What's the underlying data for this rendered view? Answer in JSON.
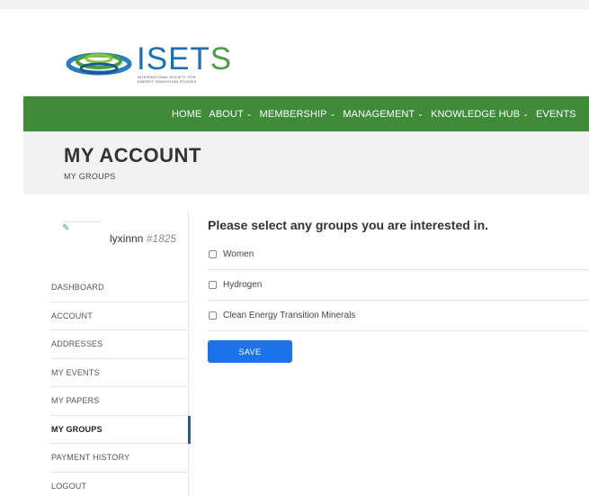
{
  "logo": {
    "word_blue": "ISET",
    "word_green": "S",
    "subtitle_line1": "INTERNATIONAL SOCIETY FOR",
    "subtitle_line2": "ENERGY TRANSITION STUDIES"
  },
  "nav": {
    "items": [
      {
        "label": "HOME",
        "dropdown": false
      },
      {
        "label": "ABOUT",
        "dropdown": true
      },
      {
        "label": "MEMBERSHIP",
        "dropdown": true
      },
      {
        "label": "MANAGEMENT",
        "dropdown": true
      },
      {
        "label": "KNOWLEDGE HUB",
        "dropdown": true
      },
      {
        "label": "EVENTS",
        "dropdown": false
      }
    ],
    "chevron": "⌄"
  },
  "header": {
    "title": "MY ACCOUNT",
    "breadcrumb": "MY GROUPS"
  },
  "user": {
    "name": "lyxinnn",
    "id": "#1825"
  },
  "sidebar": {
    "items": [
      {
        "label": "DASHBOARD",
        "active": false
      },
      {
        "label": "ACCOUNT",
        "active": false
      },
      {
        "label": "ADDRESSES",
        "active": false
      },
      {
        "label": "MY EVENTS",
        "active": false
      },
      {
        "label": "MY PAPERS",
        "active": false
      },
      {
        "label": "MY GROUPS",
        "active": true
      },
      {
        "label": "PAYMENT HISTORY",
        "active": false
      },
      {
        "label": "LOGOUT",
        "active": false
      }
    ]
  },
  "main": {
    "title": "Please select any groups you are interested in.",
    "groups": [
      {
        "label": "Women",
        "checked": false
      },
      {
        "label": "Hydrogen",
        "checked": false
      },
      {
        "label": "Clean Energy Transition Minerals",
        "checked": false
      }
    ],
    "save_label": "SAVE"
  },
  "colors": {
    "nav_green": "#3f8b3a",
    "brand_blue": "#1e6fb3",
    "brand_green": "#4aa043",
    "save_blue": "#1a73e8",
    "active_indicator": "#2e5c8a"
  }
}
